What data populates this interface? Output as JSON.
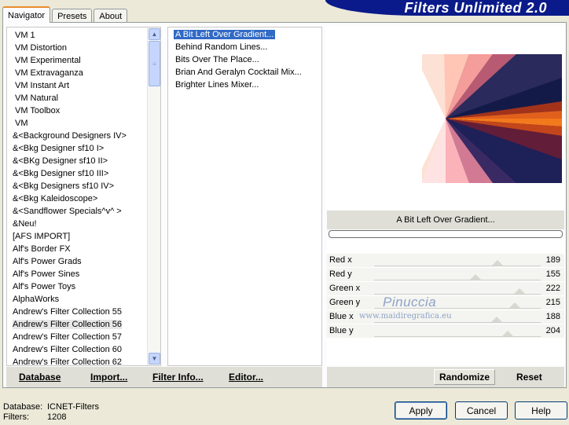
{
  "app": {
    "brand_title": "Filters Unlimited 2.0"
  },
  "tabs": [
    {
      "label": "Navigator"
    },
    {
      "label": "Presets"
    },
    {
      "label": "About"
    }
  ],
  "categories": [
    "VM 1",
    "VM Distortion",
    "VM Experimental",
    "VM Extravaganza",
    "VM Instant Art",
    "VM Natural",
    "VM Toolbox",
    "VM",
    "&<Background Designers IV>",
    "&<Bkg Designer sf10 I>",
    "&<BKg Designer sf10 II>",
    "&<Bkg Designer sf10 III>",
    "&<Bkg Designers sf10 IV>",
    "&<Bkg Kaleidoscope>",
    "&<Sandflower Specials^v^ >",
    "&Neu!",
    "[AFS IMPORT]",
    "Alf's Border FX",
    "Alf's Power Grads",
    "Alf's Power Sines",
    "Alf's Power Toys",
    "AlphaWorks",
    "Andrew's Filter Collection 55",
    "Andrew's Filter Collection 56",
    "Andrew's Filter Collection 57",
    "Andrew's Filter Collection 60",
    "Andrew's Filter Collection 62"
  ],
  "filters": [
    "A Bit Left Over Gradient...",
    "Behind Random Lines...",
    "Bits Over The Place...",
    "Brian And Geralyn Cocktail Mix...",
    "Brighter Lines Mixer..."
  ],
  "selected_filter_name": "A Bit Left Over Gradient...",
  "params": [
    {
      "label": "Red x",
      "value": "189",
      "level": 189
    },
    {
      "label": "Red y",
      "value": "155",
      "level": 155
    },
    {
      "label": "Green x",
      "value": "222",
      "level": 222
    },
    {
      "label": "Green y",
      "value": "215",
      "level": 215
    },
    {
      "label": "Blue x",
      "value": "188",
      "level": 188
    },
    {
      "label": "Blue y",
      "value": "204",
      "level": 204
    }
  ],
  "watermark": {
    "name": "Pinuccia",
    "url": "www.maidiregrafica.eu"
  },
  "bottom_left": {
    "database": "Database",
    "import": "Import...",
    "filter_info": "Filter Info...",
    "editor": "Editor..."
  },
  "bottom_right": {
    "randomize": "Randomize",
    "reset": "Reset"
  },
  "status": {
    "database_label": "Database:",
    "database_value": "ICNET-Filters",
    "filters_label": "Filters:",
    "filters_value": "1208"
  },
  "dialog": {
    "apply": "Apply",
    "cancel": "Cancel",
    "help": "Help"
  },
  "colors": {
    "accent_tab": "#e68b2c",
    "selection": "#316ac5",
    "brand": "#0a1a8a"
  }
}
